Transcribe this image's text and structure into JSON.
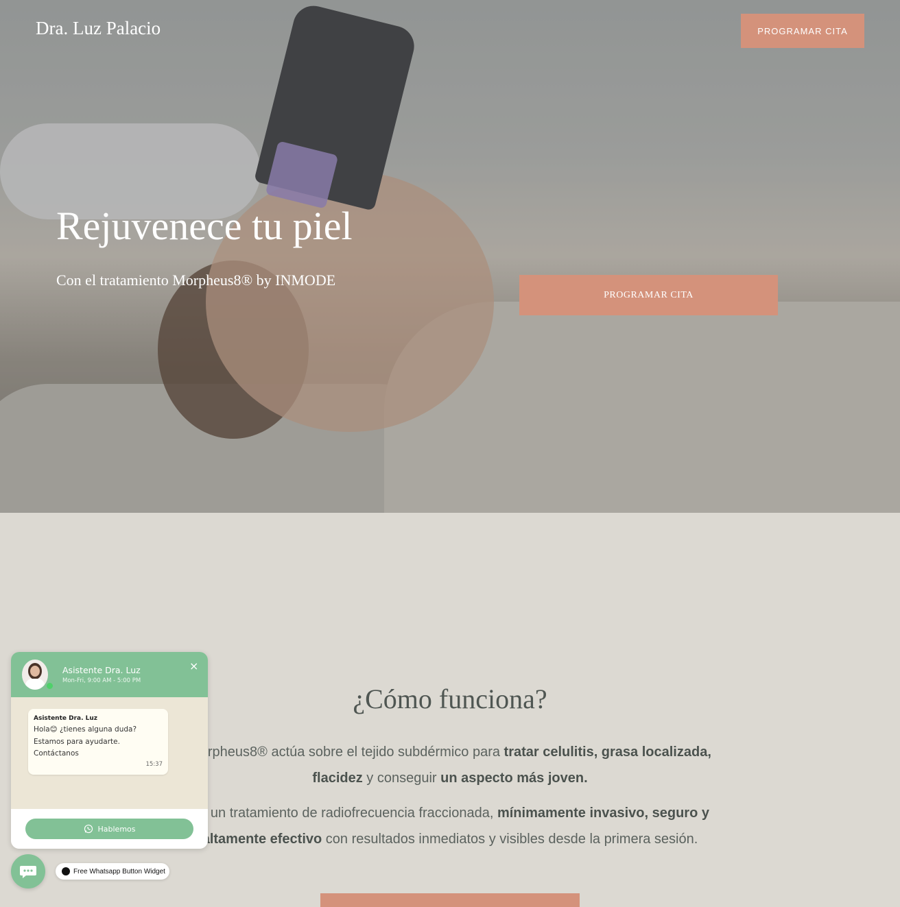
{
  "header": {
    "brand": "Dra. Luz Palacio",
    "cta_label": "PROGRAMAR CITA"
  },
  "hero": {
    "title": "Rejuvenece tu piel",
    "subtitle": "Con el tratamiento Morpheus8® by INMODE",
    "cta_label": "PROGRAMAR CITA"
  },
  "how_it_works": {
    "title": "¿Cómo funciona?",
    "p1_a": "Morpheus8® actúa sobre el tejido subdérmico para ",
    "p1_b": "tratar celulitis, grasa localizada, flacidez",
    "p1_c": " y conseguir ",
    "p1_d": "un aspecto más joven.",
    "p2_a": "Es un tratamiento de radiofrecuencia fraccionada, ",
    "p2_b": "mínimamente invasivo, seguro y altamente efectivo",
    "p2_c": " con resultados inmediatos y visibles desde la primera sesión."
  },
  "chat": {
    "name": "Asistente Dra. Luz",
    "hours": "Mon-Fri, 9:00 AM - 5:00 PM",
    "close": "×",
    "message_sender": "Asistente Dra. Luz",
    "message_text": "Hola😊 ¿tienes alguna duda?\nEstamos para ayudarte.\nContáctanos",
    "message_time": "15:37",
    "button_label": "Hablemos"
  },
  "widget_tag": "Free Whatsapp Button Widget",
  "colors": {
    "accent": "#d4927b",
    "chat_green": "#82c196",
    "section_bg": "#dcd9d2"
  }
}
